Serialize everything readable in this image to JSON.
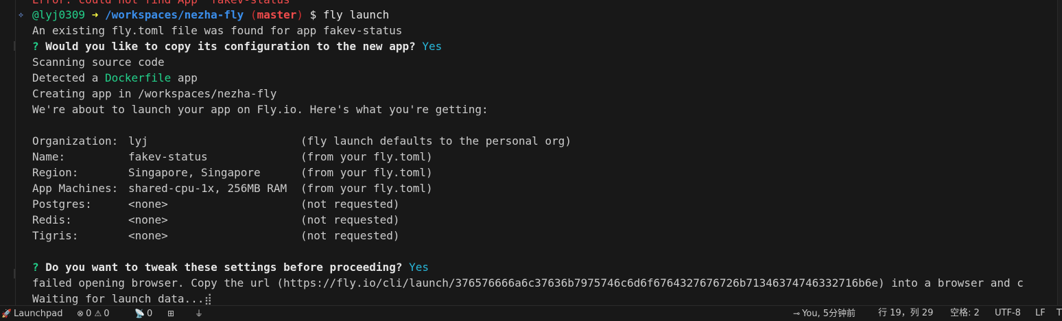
{
  "terminal": {
    "error_line": "Error: could not find App \"fakev-status\"",
    "prompt": {
      "user": "@lyj0309",
      "arrow": "➜",
      "path": "/workspaces/nezha-fly",
      "open_paren": "(",
      "branch": "master",
      "close_paren": ")",
      "command": "$ fly launch"
    },
    "line_existing": "An existing fly.toml file was found for app fakev-status",
    "q1": {
      "mark": "?",
      "text": "Would you like to copy its configuration to the new app?",
      "answer": "Yes"
    },
    "line_scanning": "Scanning source code",
    "detected": {
      "pre": "Detected a ",
      "highlight": "Dockerfile",
      "post": " app"
    },
    "line_creating": "Creating app in /workspaces/nezha-fly",
    "line_about": "We're about to launch your app on Fly.io. Here's what you're getting:",
    "settings": [
      {
        "label": "Organization:",
        "value": "lyj",
        "note": "(fly launch defaults to the personal org)"
      },
      {
        "label": "Name:",
        "value": "fakev-status",
        "note": "(from your fly.toml)"
      },
      {
        "label": "Region:",
        "value": "Singapore, Singapore",
        "note": "(from your fly.toml)"
      },
      {
        "label": "App Machines:",
        "value": "shared-cpu-1x, 256MB RAM",
        "note": "(from your fly.toml)"
      },
      {
        "label": "Postgres:",
        "value": "<none>",
        "note": "(not requested)"
      },
      {
        "label": "Redis:",
        "value": "<none>",
        "note": "(not requested)"
      },
      {
        "label": "Tigris:",
        "value": "<none>",
        "note": "(not requested)"
      }
    ],
    "q2": {
      "mark": "?",
      "text": "Do you want to tweak these settings before proceeding?",
      "answer": "Yes"
    },
    "line_failed": "failed opening browser. Copy the url (https://fly.io/cli/launch/376576666a6c37636b7975746c6d6f6764327676726b71346374746332716b6e) into a browser and c",
    "line_waiting": "Waiting for launch data...",
    "spinner": "⣾"
  },
  "statusbar": {
    "launchpad": "Launchpad",
    "errors": "0",
    "warnings": "0",
    "ports": "0",
    "blame": "You, 5分钟前",
    "position": "行 19，列 29",
    "spaces": "空格: 2",
    "encoding": "UTF-8",
    "eol": "LF",
    "extra": "T"
  },
  "colors": {
    "background": "#181818",
    "text": "#cccccc",
    "green": "#23d18b",
    "cyan": "#29b8db",
    "blue": "#3b8eea",
    "red": "#f14c4c"
  }
}
